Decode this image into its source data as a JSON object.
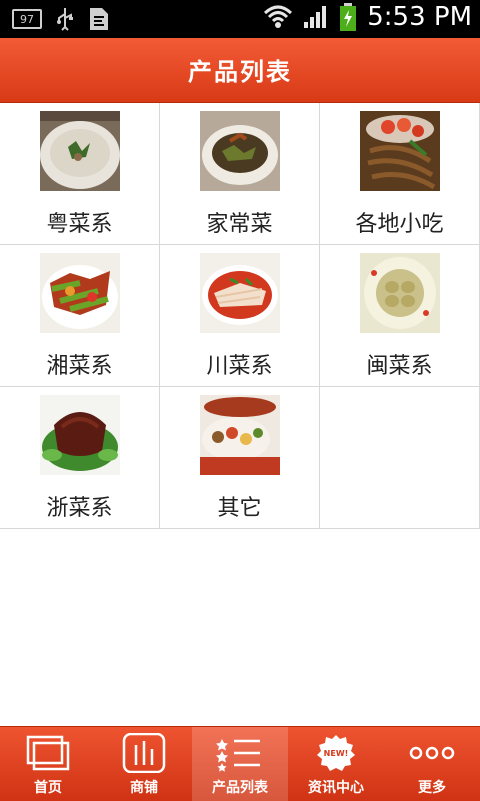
{
  "status_bar": {
    "notification_badge": "97",
    "time": "5:53 PM"
  },
  "header": {
    "title": "产品列表"
  },
  "grid": {
    "items": [
      {
        "label": "粤菜系"
      },
      {
        "label": "家常菜"
      },
      {
        "label": "各地小吃"
      },
      {
        "label": "湘菜系"
      },
      {
        "label": "川菜系"
      },
      {
        "label": "闽菜系"
      },
      {
        "label": "浙菜系"
      },
      {
        "label": "其它"
      }
    ]
  },
  "tabbar": {
    "tabs": [
      {
        "label": "首页",
        "icon": "pages-icon"
      },
      {
        "label": "商铺",
        "icon": "shop-bars-icon"
      },
      {
        "label": "产品列表",
        "icon": "list-icon",
        "active": true
      },
      {
        "label": "资讯中心",
        "icon": "new-badge-icon"
      },
      {
        "label": "更多",
        "icon": "more-dots-icon"
      }
    ]
  },
  "colors": {
    "header_top": "#f25b35",
    "header_bottom": "#d83a16",
    "grid_line": "#d8d8d8"
  }
}
